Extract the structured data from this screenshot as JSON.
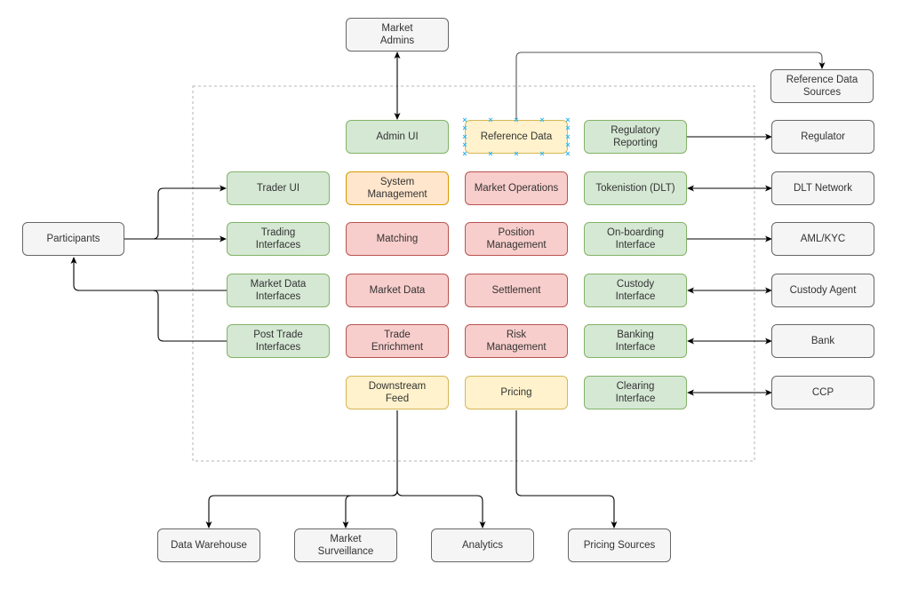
{
  "diagram": {
    "colors": {
      "internal_interface": "#d5e8d4",
      "core_service": "#f8cecc",
      "auxiliary_service": "#fff2cc",
      "system_service": "#ffe6cc",
      "external": "#f5f5f5",
      "selection": "#29b6f2"
    },
    "external": {
      "market_admins": "Market\nAdmins",
      "reference_data_sources": "Reference Data\nSources",
      "participants": "Participants",
      "regulator": "Regulator",
      "dlt_network": "DLT Network",
      "aml_kyc": "AML/KYC",
      "custody_agent": "Custody Agent",
      "bank": "Bank",
      "ccp": "CCP",
      "data_warehouse": "Data Warehouse",
      "market_surveillance": "Market\nSurveillance",
      "analytics": "Analytics",
      "pricing_sources": "Pricing Sources"
    },
    "col1": {
      "trader_ui": "Trader UI",
      "trading_interfaces": "Trading\nInterfaces",
      "market_data_interfaces": "Market Data\nInterfaces",
      "post_trade_interfaces": "Post Trade\nInterfaces"
    },
    "col2": {
      "admin_ui": "Admin UI",
      "system_management": "System\nManagement",
      "matching": "Matching",
      "market_data": "Market Data",
      "trade_enrichment": "Trade\nEnrichment",
      "downstream_feed": "Downstream\nFeed"
    },
    "col3": {
      "reference_data": "Reference Data",
      "market_operations": "Market Operations",
      "position_management": "Position\nManagement",
      "settlement": "Settlement",
      "risk_management": "Risk\nManagement",
      "pricing": "Pricing"
    },
    "col4": {
      "regulatory_reporting": "Regulatory\nReporting",
      "tokenisation": "Tokenistion (DLT)",
      "onboarding_interface": "On-boarding\nInterface",
      "custody_interface": "Custody\nInterface",
      "banking_interface": "Banking\nInterface",
      "clearing_interface": "Clearing\nInterface"
    },
    "selected_node": "Reference Data"
  }
}
